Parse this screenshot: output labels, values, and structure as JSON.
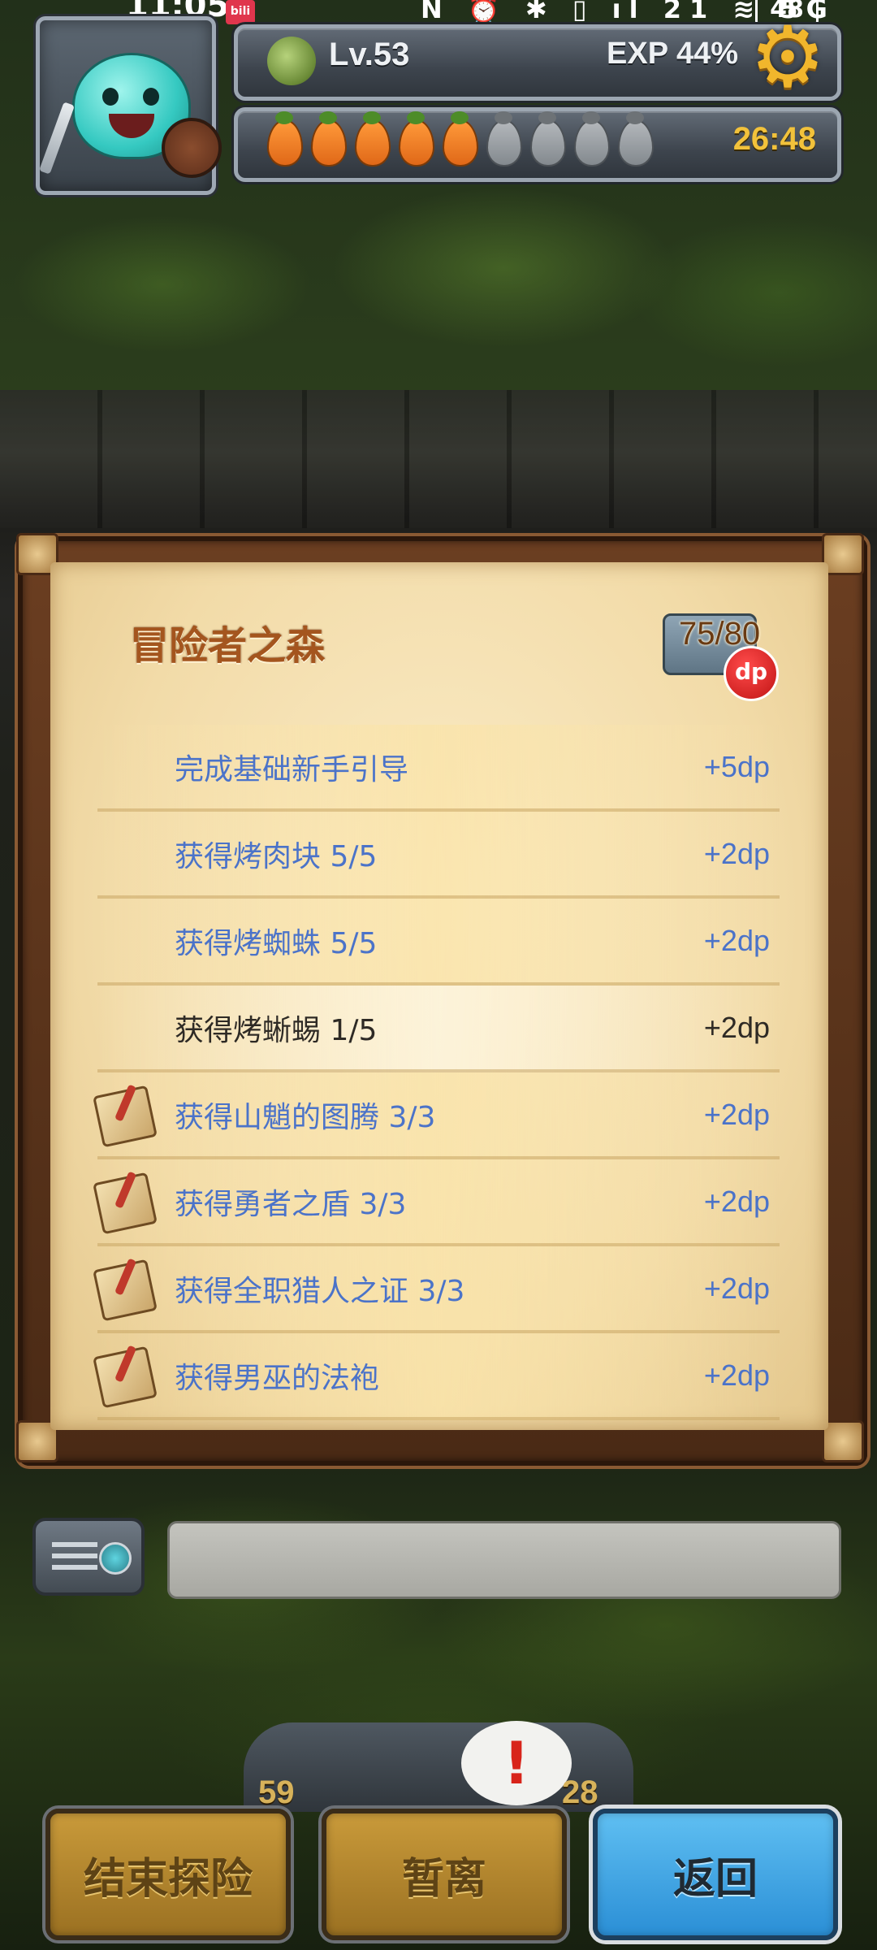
{
  "status_bar": {
    "time": "11:05",
    "app_badge": "bili",
    "indicators": "N ⏰ ✱ ▯ ıl 21 ≋ 5G ıl",
    "battery": "48"
  },
  "player": {
    "level": "Lv.53",
    "exp": "EXP 44%",
    "energy_full": 5,
    "energy_total": 9,
    "timer": "26:48",
    "settings_icon": "gear-icon"
  },
  "dungeon_panel": {
    "title": "冒险者之森",
    "score": "75/80",
    "badge": "dp",
    "tasks": [
      {
        "label": "完成基础新手引导",
        "reward": "+5dp",
        "completed": true,
        "scroll_icon": false
      },
      {
        "label": "获得烤肉块 5/5",
        "reward": "+2dp",
        "completed": true,
        "scroll_icon": false
      },
      {
        "label": "获得烤蜘蛛 5/5",
        "reward": "+2dp",
        "completed": true,
        "scroll_icon": false
      },
      {
        "label": "获得烤蜥蜴 1/5",
        "reward": "+2dp",
        "completed": false,
        "scroll_icon": false
      },
      {
        "label": "获得山魈的图腾 3/3",
        "reward": "+2dp",
        "completed": true,
        "scroll_icon": true
      },
      {
        "label": "获得勇者之盾 3/3",
        "reward": "+2dp",
        "completed": true,
        "scroll_icon": true
      },
      {
        "label": "获得全职猎人之证 3/3",
        "reward": "+2dp",
        "completed": true,
        "scroll_icon": true
      },
      {
        "label": "获得男巫的法袍",
        "reward": "+2dp",
        "completed": true,
        "scroll_icon": true
      }
    ]
  },
  "chat": {
    "icon": "chat-log-icon",
    "placeholder": ""
  },
  "bottom": {
    "alert": "!",
    "left_count": "59",
    "right_count": "28",
    "end_label": "结束探险",
    "away_label": "暂离",
    "back_label": "返回"
  },
  "colors": {
    "task_done": "#4b73c9",
    "task_current": "#2e2a25",
    "title": "#a4551e",
    "timer": "#f2c23b",
    "back_button": "#3ca3e6"
  }
}
